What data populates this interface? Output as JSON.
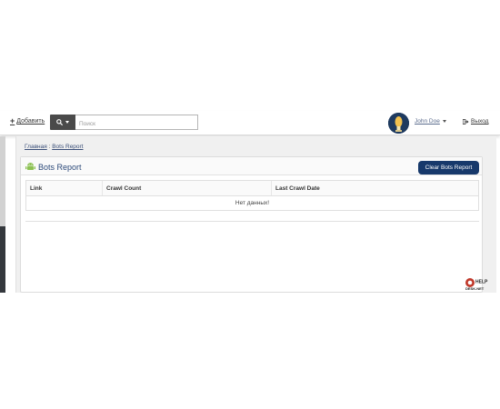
{
  "topbar": {
    "add_label": "Добавить",
    "search_placeholder": "Поиск",
    "user_name": "John Doe",
    "logout_label": "Выход"
  },
  "breadcrumb": {
    "home": "Главная",
    "separator": ":",
    "current": "Bots Report"
  },
  "panel": {
    "title": "Bots Report",
    "clear_button": "Clear Bots Report"
  },
  "table": {
    "columns": [
      "Link",
      "Crawl Count",
      "Last Crawl Date"
    ],
    "empty_message": "Нет данных!"
  },
  "help_widget": {
    "line1": "HELP",
    "line2": "DESK.NET"
  },
  "colors": {
    "primary_button": "#17396b",
    "title_blue": "#2d4a7a",
    "sidebar_dark": "#34383d",
    "android_green": "#8cc152"
  },
  "icons": [
    "plus-icon",
    "search-icon",
    "caret-down-icon",
    "avatar",
    "sign-out-icon",
    "android-icon",
    "help-icon"
  ]
}
